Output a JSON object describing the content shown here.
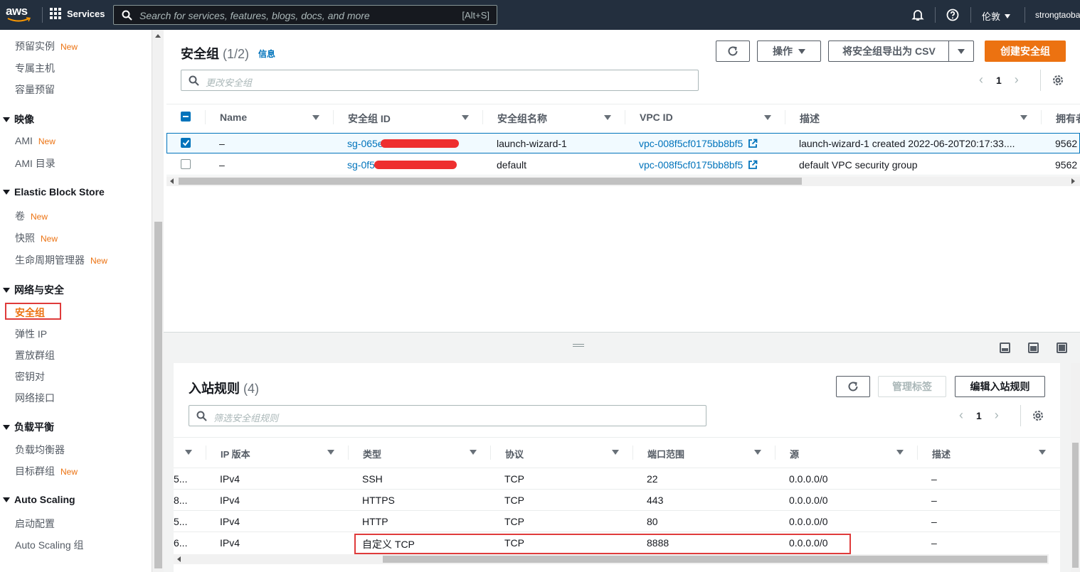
{
  "topnav": {
    "logo": "aws",
    "services": "Services",
    "search_placeholder": "Search for services, features, blogs, docs, and more",
    "search_shortcut": "[Alt+S]",
    "region": "伦敦",
    "account": "strongtaoba"
  },
  "sidebar": {
    "items": [
      {
        "label": "预留实例",
        "badge": "New"
      },
      {
        "label": "专属主机",
        "badge": ""
      },
      {
        "label": "容量预留",
        "badge": ""
      }
    ],
    "sections": [
      {
        "title": "映像",
        "items": [
          {
            "label": "AMI",
            "badge": "New"
          },
          {
            "label": "AMI 目录",
            "badge": ""
          }
        ]
      },
      {
        "title": "Elastic Block Store",
        "items": [
          {
            "label": "卷",
            "badge": "New"
          },
          {
            "label": "快照",
            "badge": "New"
          },
          {
            "label": "生命周期管理器",
            "badge": "New"
          }
        ]
      },
      {
        "title": "网络与安全",
        "items": [
          {
            "label": "安全组",
            "badge": ""
          },
          {
            "label": "弹性 IP",
            "badge": ""
          },
          {
            "label": "置放群组",
            "badge": ""
          },
          {
            "label": "密钥对",
            "badge": ""
          },
          {
            "label": "网络接口",
            "badge": ""
          }
        ]
      },
      {
        "title": "负载平衡",
        "items": [
          {
            "label": "负载均衡器",
            "badge": ""
          },
          {
            "label": "目标群组",
            "badge": "New"
          }
        ]
      },
      {
        "title": "Auto Scaling",
        "items": [
          {
            "label": "启动配置",
            "badge": ""
          },
          {
            "label": "Auto Scaling 组",
            "badge": ""
          }
        ]
      }
    ]
  },
  "security_groups": {
    "title": "安全组",
    "count": "(1/2)",
    "info": "信息",
    "actions_label": "操作",
    "export_label": "将安全组导出为 CSV",
    "create_label": "创建安全组",
    "filter_placeholder": "更改安全组",
    "page": "1",
    "columns": [
      "Name",
      "安全组 ID",
      "安全组名称",
      "VPC ID",
      "描述",
      "拥有者"
    ],
    "rows": [
      {
        "name": "–",
        "id": "sg-065e",
        "group_name": "launch-wizard-1",
        "vpc": "vpc-008f5cf0175bb8bf5",
        "desc": "launch-wizard-1 created 2022-06-20T20:17:33....",
        "owner": "9562",
        "selected": true
      },
      {
        "name": "–",
        "id": "sg-0f54",
        "group_name": "default",
        "vpc": "vpc-008f5cf0175bb8bf5",
        "desc": "default VPC security group",
        "owner": "9562",
        "selected": false
      }
    ]
  },
  "inbound": {
    "title": "入站规则",
    "count": "(4)",
    "manage_tags_label": "管理标签",
    "edit_label": "编辑入站规则",
    "filter_placeholder": "筛选安全组规则",
    "page": "1",
    "columns": [
      "IP 版本",
      "类型",
      "协议",
      "端口范围",
      "源",
      "描述"
    ],
    "rows": [
      {
        "rule": "5...",
        "ip": "IPv4",
        "type": "SSH",
        "proto": "TCP",
        "port": "22",
        "src": "0.0.0.0/0",
        "desc": "–"
      },
      {
        "rule": "8...",
        "ip": "IPv4",
        "type": "HTTPS",
        "proto": "TCP",
        "port": "443",
        "src": "0.0.0.0/0",
        "desc": "–"
      },
      {
        "rule": "5...",
        "ip": "IPv4",
        "type": "HTTP",
        "proto": "TCP",
        "port": "80",
        "src": "0.0.0.0/0",
        "desc": "–"
      },
      {
        "rule": "6...",
        "ip": "IPv4",
        "type": "自定义 TCP",
        "proto": "TCP",
        "port": "8888",
        "src": "0.0.0.0/0",
        "desc": "–"
      }
    ]
  },
  "colors": {
    "nav_bg": "#232f3e",
    "accent": "#ec7211",
    "link": "#0073bb",
    "highlight": "#df3b3b"
  }
}
